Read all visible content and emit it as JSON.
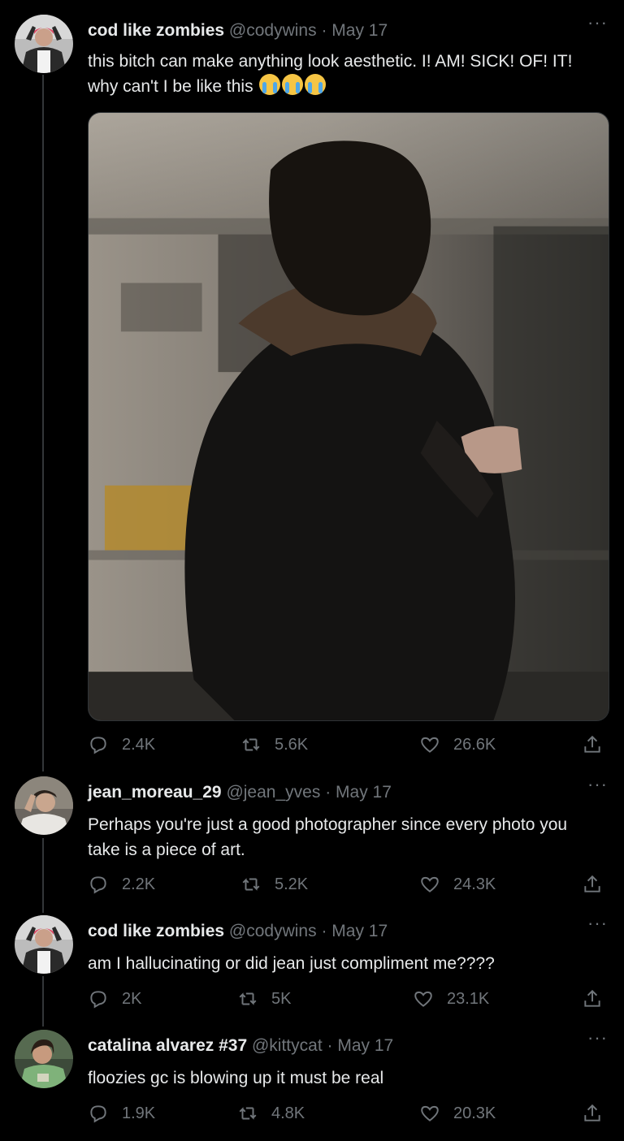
{
  "tweets": [
    {
      "name": "cod like zombies",
      "handle": "@codywins",
      "separator": "·",
      "date": "May 17",
      "text_line1": "this bitch can make anything look aesthetic. I! AM! SICK! OF! IT!",
      "text_line2": "why can't I be like this",
      "emojis": "😭😭😭",
      "replies": "2.4K",
      "retweets": "5.6K",
      "likes": "26.6K",
      "more": "···"
    },
    {
      "name": "jean_moreau_29",
      "handle": "@jean_yves",
      "separator": "·",
      "date": "May 17",
      "text_line1": "Perhaps you're just a good photographer since every photo you",
      "text_line2": "take is a piece of art.",
      "replies": "2.2K",
      "retweets": "5.2K",
      "likes": "24.3K",
      "more": "···"
    },
    {
      "name": "cod like zombies",
      "handle": "@codywins",
      "separator": "·",
      "date": "May 17",
      "text_line1": "am I hallucinating or did jean just compliment me????",
      "replies": "2K",
      "retweets": "5K",
      "likes": "23.1K",
      "more": "···"
    },
    {
      "name": "catalina alvarez #37",
      "handle": "@kittycat",
      "separator": "·",
      "date": "May 17",
      "text_line1": "floozies gc is blowing up it must be real",
      "replies": "1.9K",
      "retweets": "4.8K",
      "likes": "20.3K",
      "more": "···"
    }
  ],
  "icons": {
    "reply": "reply-icon",
    "retweet": "retweet-icon",
    "like": "heart-icon",
    "share": "share-icon"
  },
  "colors": {
    "background": "#000000",
    "text": "#e7e9ea",
    "secondary": "#71767b",
    "thread_line": "#333639"
  }
}
